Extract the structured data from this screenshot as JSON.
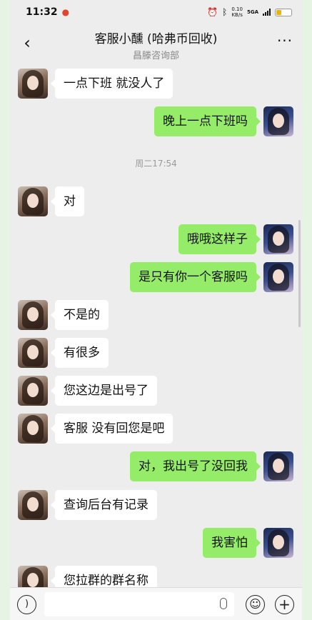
{
  "status_bar": {
    "time": "11:32",
    "net_speed_value": "0.10",
    "net_speed_unit": "KB/s",
    "network": "5GA",
    "notification_icon": "app-notification-icon",
    "alarm_icon": "alarm-icon",
    "bluetooth_icon": "bluetooth-icon",
    "battery_level": 0.35,
    "battery_color": "#f0b400"
  },
  "header": {
    "title": "客服小醺 (哈弗币回收)",
    "subtitle": "昌滕咨询部",
    "back_icon": "‹",
    "more_icon": "···"
  },
  "timestamp": "周二17:54",
  "messages": [
    {
      "side": "left",
      "text": "一点下班 就没人了"
    },
    {
      "side": "right",
      "text": "晚上一点下班吗"
    },
    {
      "side": "left",
      "text": "对"
    },
    {
      "side": "right",
      "text": "哦哦这样子"
    },
    {
      "side": "right",
      "text": "是只有你一个客服吗"
    },
    {
      "side": "left",
      "text": " 不是的"
    },
    {
      "side": "left",
      "text": "有很多"
    },
    {
      "side": "left",
      "text": "您这边是出号了"
    },
    {
      "side": "left",
      "text": "客服 没有回您是吧"
    },
    {
      "side": "right",
      "text": "对，我出号了没回我"
    },
    {
      "side": "left",
      "text": "查询后台有记录"
    },
    {
      "side": "right",
      "text": "我害怕"
    },
    {
      "side": "left",
      "text": "您拉群的群名称"
    }
  ],
  "input_bar": {
    "voice_icon": "voice-icon",
    "emoji_icon": "emoji-icon",
    "plus_icon": "plus-icon",
    "mic_icon": "mic-icon"
  },
  "colors": {
    "self_bubble": "#95ec69",
    "other_bubble": "#ffffff",
    "background": "#ededed"
  }
}
